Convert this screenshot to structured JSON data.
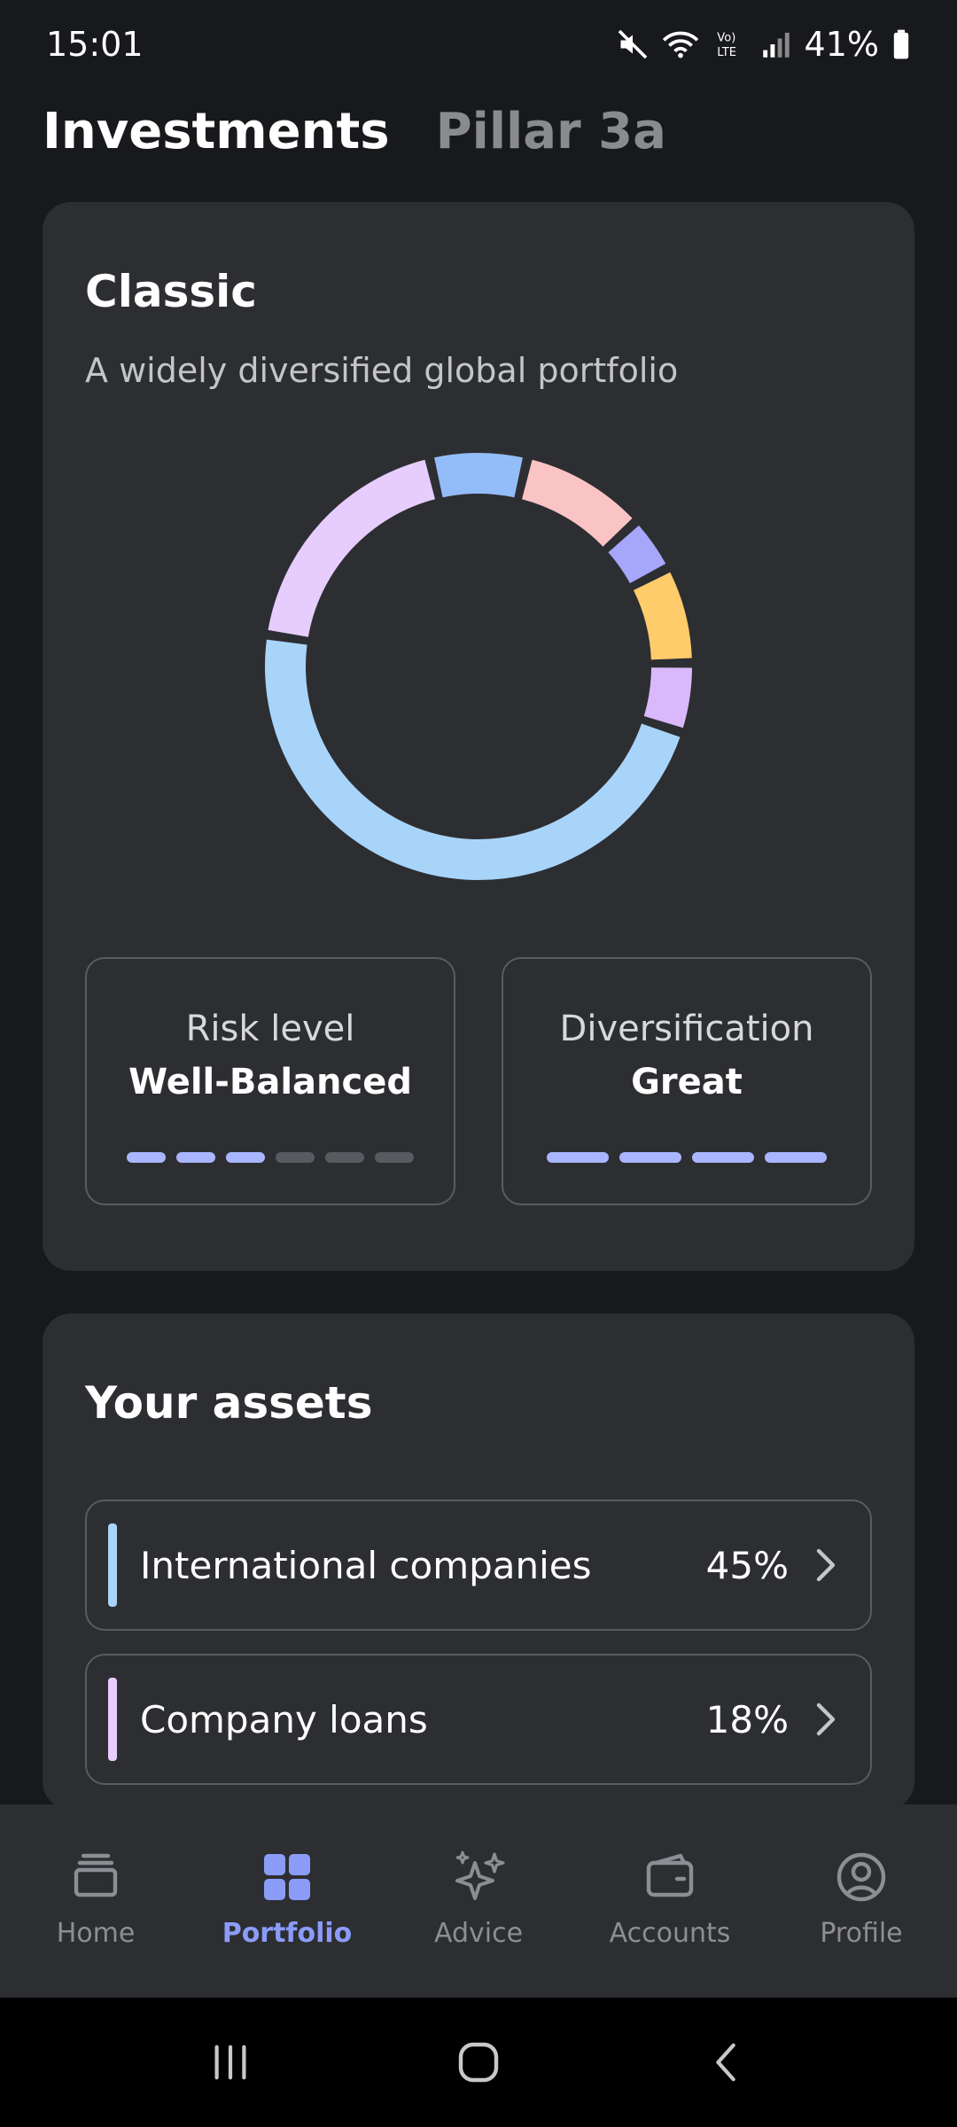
{
  "status_bar": {
    "time": "15:01",
    "battery": "41%",
    "icons": [
      "mute-icon",
      "wifi-icon",
      "volte-icon",
      "signal-icon",
      "battery-icon"
    ]
  },
  "header": {
    "tabs": [
      {
        "label": "Investments",
        "active": true
      },
      {
        "label": "Pillar 3a",
        "active": false
      }
    ]
  },
  "portfolio": {
    "title": "Classic",
    "subtitle": "A widely diversified global portfolio",
    "allocation": [
      {
        "value": 45,
        "color": "#a8d4fa"
      },
      {
        "value": 18,
        "color": "#e6cdfd"
      },
      {
        "value": 7,
        "color": "#93bdf8"
      },
      {
        "value": 9,
        "color": "#fbc4c4"
      },
      {
        "value": 4,
        "color": "#a6a6fb"
      },
      {
        "value": 7,
        "color": "#ffcc6b"
      },
      {
        "value": 5,
        "color": "#d9b9fb"
      }
    ],
    "risk": {
      "label": "Risk level",
      "value": "Well-Balanced",
      "filled": 3,
      "total": 6
    },
    "diversification": {
      "label": "Diversification",
      "value": "Great",
      "filled": 4,
      "total": 4
    }
  },
  "assets": {
    "title": "Your assets",
    "items": [
      {
        "name": "International companies",
        "percent": "45%",
        "color": "#a8d4fa"
      },
      {
        "name": "Company loans",
        "percent": "18%",
        "color": "#e6cdfd"
      }
    ]
  },
  "bottom_nav": {
    "items": [
      {
        "label": "Home",
        "icon": "stack-icon",
        "active": false
      },
      {
        "label": "Portfolio",
        "icon": "grid-icon",
        "active": true
      },
      {
        "label": "Advice",
        "icon": "sparkle-icon",
        "active": false
      },
      {
        "label": "Accounts",
        "icon": "wallet-icon",
        "active": false
      },
      {
        "label": "Profile",
        "icon": "profile-icon",
        "active": false
      }
    ]
  },
  "colors": {
    "background": "#18191c",
    "card": "#2d2e32",
    "accent": "#8b9cf8",
    "dash_on": "#a9b6ff"
  }
}
